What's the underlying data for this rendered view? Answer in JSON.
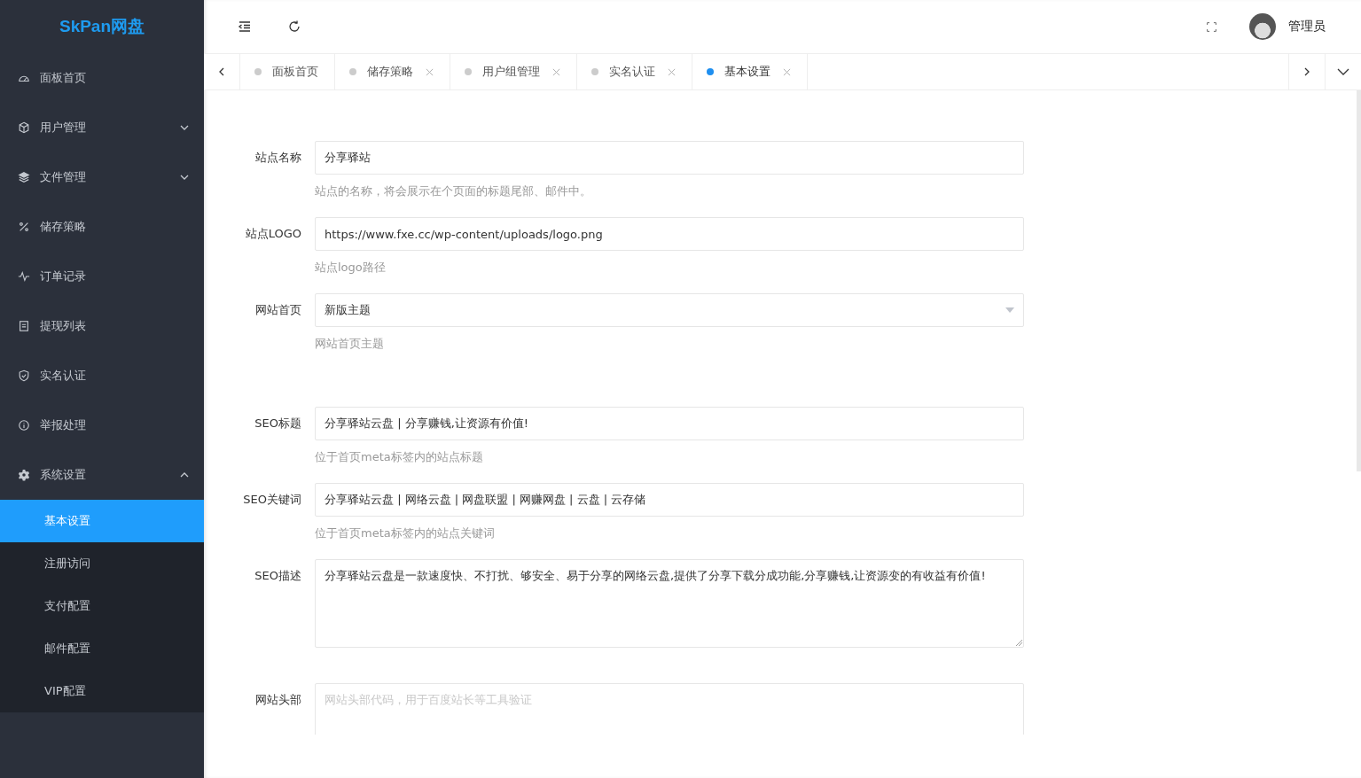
{
  "sidebar": {
    "logo": "SkPan网盘",
    "items": [
      {
        "label": "面板首页",
        "selected": false
      },
      {
        "label": "用户管理",
        "selected": false,
        "expanded": false
      },
      {
        "label": "文件管理",
        "selected": false,
        "expanded": false
      },
      {
        "label": "储存策略",
        "selected": false
      },
      {
        "label": "订单记录",
        "selected": false
      },
      {
        "label": "提现列表",
        "selected": false
      },
      {
        "label": "实名认证",
        "selected": false
      },
      {
        "label": "举报处理",
        "selected": false
      },
      {
        "label": "系统设置",
        "selected": false,
        "expanded": true,
        "children": [
          {
            "label": "基本设置",
            "selected": true
          },
          {
            "label": "注册访问",
            "selected": false
          },
          {
            "label": "支付配置",
            "selected": false
          },
          {
            "label": "邮件配置",
            "selected": false
          },
          {
            "label": "VIP配置",
            "selected": false
          }
        ]
      }
    ]
  },
  "header": {
    "user": "管理员"
  },
  "tabs": [
    {
      "label": "面板首页",
      "selected": false,
      "closable": false
    },
    {
      "label": "储存策略",
      "selected": false,
      "closable": true
    },
    {
      "label": "用户组管理",
      "selected": false,
      "closable": true
    },
    {
      "label": "实名认证",
      "selected": false,
      "closable": true
    },
    {
      "label": "基本设置",
      "selected": true,
      "closable": true
    }
  ],
  "form": [
    {
      "kind": "input",
      "label": "站点名称",
      "value": "分享驿站",
      "help": "站点的名称，将会展示在个页面的标题尾部、邮件中。"
    },
    {
      "kind": "input",
      "label": "站点LOGO",
      "value": "https://www.fxe.cc/wp-content/uploads/logo.png",
      "help": "站点logo路径"
    },
    {
      "kind": "select",
      "label": "网站首页",
      "value": "新版主题",
      "help": "网站首页主题"
    },
    {
      "kind": "input",
      "label": "SEO标题",
      "value": "分享驿站云盘 | 分享赚钱,让资源有价值!",
      "help": "位于首页meta标签内的站点标题"
    },
    {
      "kind": "input",
      "label": "SEO关键词",
      "value": "分享驿站云盘 | 网络云盘 | 网盘联盟 | 网赚网盘 | 云盘 | 云存储",
      "help": "位于首页meta标签内的站点关键词"
    },
    {
      "kind": "textarea",
      "label": "SEO描述",
      "value": "分享驿站云盘是一款速度快、不打扰、够安全、易于分享的网络云盘,提供了分享下载分成功能,分享赚钱,让资源变的有收益有价值!"
    },
    {
      "kind": "textarea",
      "label": "网站头部",
      "placeholder": "网站头部代码，用于百度站长等工具验证"
    }
  ]
}
